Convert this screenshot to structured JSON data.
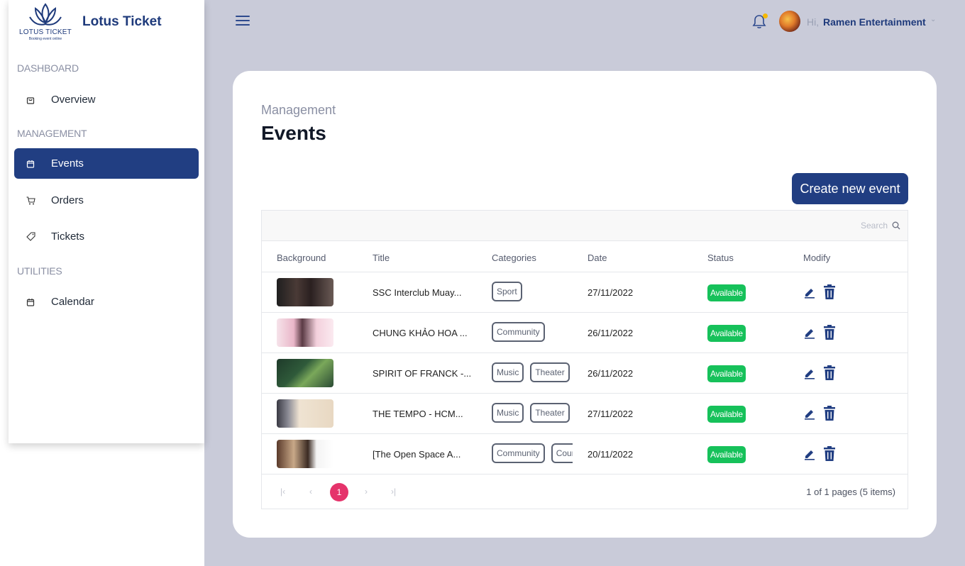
{
  "app": {
    "logo_text": "LOTUS TICKET",
    "logo_tagline": "Booking event online",
    "brand_name": "Lotus Ticket"
  },
  "sidebar": {
    "sections": [
      {
        "label": "DASHBOARD"
      },
      {
        "label": "MANAGEMENT"
      },
      {
        "label": "UTILITIES"
      }
    ],
    "items": [
      {
        "label": "Overview",
        "icon": "shopping-bag-icon",
        "active": false
      },
      {
        "label": "Events",
        "icon": "calendar-icon",
        "active": true
      },
      {
        "label": "Orders",
        "icon": "cart-icon",
        "active": false
      },
      {
        "label": "Tickets",
        "icon": "tag-icon",
        "active": false
      },
      {
        "label": "Calendar",
        "icon": "calendar-icon",
        "active": false
      }
    ]
  },
  "topbar": {
    "greeting": "Hi,",
    "user_name": "Ramen Entertainment",
    "has_notification": true
  },
  "page": {
    "breadcrumb": "Management",
    "title": "Events",
    "create_button_label": "Create new event"
  },
  "search": {
    "placeholder": "Search"
  },
  "table": {
    "columns": [
      "Background",
      "Title",
      "Categories",
      "Date",
      "Status",
      "Modify"
    ],
    "rows": [
      {
        "title": "SSC Interclub Muay...",
        "categories": [
          "Sport"
        ],
        "date": "27/11/2022",
        "status": "Available"
      },
      {
        "title": "CHUNG KHẢO HOA ...",
        "categories": [
          "Community"
        ],
        "date": "26/11/2022",
        "status": "Available"
      },
      {
        "title": "SPIRIT OF FRANCK -...",
        "categories": [
          "Music",
          "Theater"
        ],
        "date": "26/11/2022",
        "status": "Available"
      },
      {
        "title": "THE TEMPO - HCM...",
        "categories": [
          "Music",
          "Theater"
        ],
        "date": "27/11/2022",
        "status": "Available"
      },
      {
        "title": "[The Open Space A...",
        "categories": [
          "Community",
          "Course"
        ],
        "date": "20/11/2022",
        "status": "Available"
      }
    ]
  },
  "pagination": {
    "first": "|‹",
    "prev": "‹",
    "current_page": "1",
    "next": "›",
    "last": "›|",
    "info": "1 of 1 pages (5 items)"
  },
  "colors": {
    "primary": "#213e82",
    "status_available": "#16c15a",
    "page_current": "#e5336b",
    "background": "#c9cbd9"
  }
}
